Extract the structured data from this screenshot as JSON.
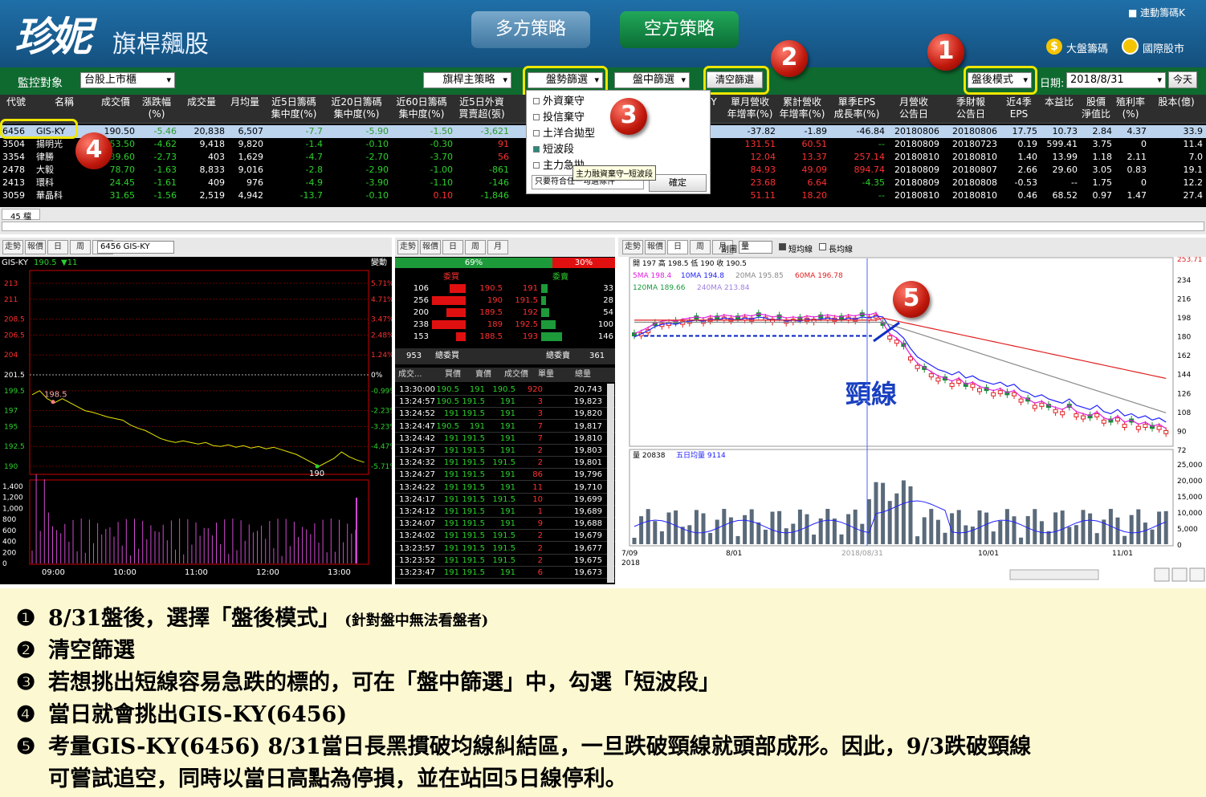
{
  "header": {
    "logo_main": "珍妮",
    "logo_sub": "旗桿飆股",
    "btn_long": "多方策略",
    "btn_short": "空方策略",
    "chip_check": "■ 連動籌碼K",
    "link_market_chips": "大盤籌碼",
    "link_global": "國際股市"
  },
  "filterbar": {
    "monitor_label": "監控對象",
    "monitor_value": "台股上市櫃",
    "strategy": "旗桿主策略",
    "trend_filter": "盤勢篩選",
    "intraday_filter": "盤中篩選",
    "clear_filter": "清空篩選",
    "mode": "盤後模式",
    "date_label": "日期:",
    "date_value": "2018/8/31",
    "today": "今天"
  },
  "callouts": [
    "1",
    "2",
    "3",
    "4",
    "5"
  ],
  "dropdown": {
    "items": [
      {
        "label": "外資棄守",
        "checked": false
      },
      {
        "label": "投信棄守",
        "checked": false
      },
      {
        "label": "土洋合拋型",
        "checked": false
      },
      {
        "label": "短波段",
        "checked": true
      },
      {
        "label": "主力急拋",
        "checked": false
      }
    ],
    "condition": "只要符合任一勾選條件",
    "ok": "確定",
    "tooltip": "主力融資棄守─短波段"
  },
  "grid": {
    "headers_left": [
      "代號",
      "名稱",
      "成交價",
      "漲跌幅\n(%)",
      "成交量",
      "月均量",
      "近5日籌碼\n集中度(%)",
      "近20日籌碼\n集中度(%)",
      "近60日籌碼\n集中度(%)",
      "近5日外資\n買賣超(張)"
    ],
    "headers_right": [
      "Y",
      "單月營收\n年增率(%)",
      "累計營收\n年增率(%)",
      "單季EPS\n成長率(%)",
      "月營收\n公告日",
      "季財報\n公告日",
      "近4季\nEPS",
      "本益比",
      "股價\n淨值比",
      "殖利率\n(%)",
      "股本(億)"
    ],
    "rows": [
      {
        "code": "6456",
        "name": "GIS-KY",
        "price": "190.50",
        "chg": "-5.46",
        "vol": "20,838",
        "mavg": "6,507",
        "c5": "-7.7",
        "c20": "-5.90",
        "c60": "-1.50",
        "f5": "-3,621",
        "m": "-37.82",
        "acc": "-1.89",
        "eps_g": "-46.84",
        "rev_d": "20180806",
        "fin_d": "20180806",
        "eps4": "17.75",
        "pe": "10.73",
        "pb": "2.84",
        "yld": "4.37",
        "cap": "33.9"
      },
      {
        "code": "3504",
        "name": "揚明光",
        "price": "53.50",
        "chg": "-4.62",
        "vol": "9,418",
        "mavg": "9,820",
        "c5": "-1.4",
        "c20": "-0.10",
        "c60": "-0.30",
        "f5": "91",
        "m": "131.51",
        "acc": "60.51",
        "eps_g": "--",
        "rev_d": "20180809",
        "fin_d": "20180723",
        "eps4": "0.19",
        "pe": "599.41",
        "pb": "3.75",
        "yld": "0",
        "cap": "11.4"
      },
      {
        "code": "3354",
        "name": "律勝",
        "price": "39.60",
        "chg": "-2.73",
        "vol": "403",
        "mavg": "1,629",
        "c5": "-4.7",
        "c20": "-2.70",
        "c60": "-3.70",
        "f5": "56",
        "m": "12.04",
        "acc": "13.37",
        "eps_g": "257.14",
        "rev_d": "20180810",
        "fin_d": "20180810",
        "eps4": "1.40",
        "pe": "13.99",
        "pb": "1.18",
        "yld": "2.11",
        "cap": "7.0"
      },
      {
        "code": "2478",
        "name": "大毅",
        "price": "78.70",
        "chg": "-1.63",
        "vol": "8,833",
        "mavg": "9,016",
        "c5": "-2.8",
        "c20": "-2.90",
        "c60": "-1.00",
        "f5": "-861",
        "m": "84.93",
        "acc": "49.09",
        "eps_g": "894.74",
        "rev_d": "20180809",
        "fin_d": "20180807",
        "eps4": "2.66",
        "pe": "29.60",
        "pb": "3.05",
        "yld": "0.83",
        "cap": "19.1"
      },
      {
        "code": "2413",
        "name": "環科",
        "price": "24.45",
        "chg": "-1.61",
        "vol": "409",
        "mavg": "976",
        "c5": "-4.9",
        "c20": "-3.90",
        "c60": "-1.10",
        "f5": "-146",
        "m": "23.68",
        "acc": "6.64",
        "eps_g": "-4.35",
        "rev_d": "20180809",
        "fin_d": "20180808",
        "eps4": "-0.53",
        "pe": "--",
        "pb": "1.75",
        "yld": "0",
        "cap": "12.2"
      },
      {
        "code": "3059",
        "name": "華晶科",
        "price": "31.65",
        "chg": "-1.56",
        "vol": "2,519",
        "mavg": "4,942",
        "c5": "-13.7",
        "c20": "-0.10",
        "c60": "0.10",
        "f5": "-1,846",
        "m": "51.11",
        "acc": "18.20",
        "eps_g": "--",
        "rev_d": "20180810",
        "fin_d": "20180810",
        "eps4": "0.46",
        "pe": "68.52",
        "pb": "0.97",
        "yld": "1.47",
        "cap": "27.4"
      }
    ],
    "count": "45 檔"
  },
  "left_chart": {
    "tabs": [
      "走勢",
      "報價",
      "日",
      "周",
      "月"
    ],
    "stock": "6456 GIS-KY",
    "title": "GIS-KY",
    "price": "190.5",
    "change": "▼11",
    "mode": "變動",
    "yticks": [
      "213",
      "211",
      "208.5",
      "206.5",
      "204",
      "201.5",
      "199.5",
      "197",
      "195",
      "192.5",
      "190"
    ],
    "pct": [
      "5.71%",
      "4.71%",
      "3.47%",
      "2.48%",
      "1.24%",
      "0%",
      "-0.99%",
      "-2.23%",
      "-3.23%",
      "-4.47%",
      "-5.71%"
    ],
    "high_label": "198.5",
    "low_label": "190",
    "vticks": [
      "1,400",
      "1,200",
      "1,000",
      "800",
      "600",
      "400",
      "200",
      "0"
    ],
    "xticks": [
      "09:00",
      "10:00",
      "11:00",
      "12:00",
      "13:00"
    ]
  },
  "mid_panel": {
    "tabs": [
      "走勢",
      "報價",
      "日",
      "周",
      "月"
    ],
    "buy_pct": "69%",
    "sell_pct": "30%",
    "buy_label": "委買",
    "sell_label": "委賣",
    "book": [
      [
        "106",
        "190.5",
        "191",
        "33"
      ],
      [
        "256",
        "190",
        "191.5",
        "28"
      ],
      [
        "200",
        "189.5",
        "192",
        "54"
      ],
      [
        "238",
        "189",
        "192.5",
        "100"
      ],
      [
        "153",
        "188.5",
        "193",
        "146"
      ]
    ],
    "tot_buy": "953",
    "tot_buy_label": "總委買",
    "tot_sell_label": "總委賣",
    "tot_sell": "361",
    "tick_headers": [
      "成交...",
      "買價",
      "賣價",
      "成交價",
      "單量",
      "總量"
    ],
    "ticks": [
      [
        "13:30:00",
        "190.5",
        "191",
        "190.5",
        "920",
        "20,743"
      ],
      [
        "13:24:57",
        "190.5",
        "191.5",
        "191",
        "3",
        "19,823"
      ],
      [
        "13:24:52",
        "191",
        "191.5",
        "191",
        "3",
        "19,820"
      ],
      [
        "13:24:47",
        "190.5",
        "191",
        "191",
        "7",
        "19,817"
      ],
      [
        "13:24:42",
        "191",
        "191.5",
        "191",
        "7",
        "19,810"
      ],
      [
        "13:24:37",
        "191",
        "191.5",
        "191",
        "2",
        "19,803"
      ],
      [
        "13:24:32",
        "191",
        "191.5",
        "191.5",
        "2",
        "19,801"
      ],
      [
        "13:24:27",
        "191",
        "191.5",
        "191",
        "86",
        "19,796"
      ],
      [
        "13:24:22",
        "191",
        "191.5",
        "191",
        "11",
        "19,710"
      ],
      [
        "13:24:17",
        "191",
        "191.5",
        "191.5",
        "10",
        "19,699"
      ],
      [
        "13:24:12",
        "191",
        "191.5",
        "191",
        "1",
        "19,689"
      ],
      [
        "13:24:07",
        "191",
        "191.5",
        "191",
        "9",
        "19,688"
      ],
      [
        "13:24:02",
        "191",
        "191.5",
        "191.5",
        "2",
        "19,679"
      ],
      [
        "13:23:57",
        "191",
        "191.5",
        "191.5",
        "2",
        "19,677"
      ],
      [
        "13:23:52",
        "191",
        "191.5",
        "191.5",
        "2",
        "19,675"
      ],
      [
        "13:23:47",
        "191",
        "191.5",
        "191",
        "6",
        "19,673"
      ]
    ]
  },
  "right_chart": {
    "tabs": [
      "走勢",
      "報價",
      "日",
      "周",
      "月"
    ],
    "sub_label": "副圖",
    "sub_value": "量",
    "short_line": "短均線",
    "long_line": "長均線",
    "ohlc": "開 197  高 198.5  低 190  收 190.5",
    "ma5": "5MA 198.4",
    "ma10": "10MA 194.8",
    "ma20": "20MA 195.85",
    "ma60": "60MA 196.78",
    "ma120": "120MA 189.66",
    "ma240": "240MA 213.84",
    "yticks": [
      "253.71",
      "234",
      "216",
      "198",
      "180",
      "162",
      "144",
      "126",
      "108",
      "90",
      "72"
    ],
    "neckline": "頸線",
    "vol_label": "量 20838",
    "vol_ma": "五日均量 9114",
    "vticks": [
      "25,000",
      "20,000",
      "15,000",
      "10,000",
      "5,000",
      "0"
    ],
    "xticks": [
      "7/09\n2018",
      "8/01",
      "2018/08/31",
      "10/01",
      "11/01"
    ]
  },
  "notes": [
    {
      "bullet": "❶",
      "text": "8/31盤後，選擇「盤後模式」",
      "small": "(針對盤中無法看盤者)"
    },
    {
      "bullet": "❷",
      "text": "清空篩選"
    },
    {
      "bullet": "❸",
      "text": "若想挑出短線容易急跌的標的，可在「盤中篩選」中，勾選「短波段」"
    },
    {
      "bullet": "❹",
      "text": "當日就會挑出GIS-KY(6456)"
    },
    {
      "bullet": "❺",
      "text": "考量GIS-KY(6456) 8/31當日長黑摜破均線糾結區，一旦跌破頸線就頭部成形。因此，9/3跌破頸線"
    },
    {
      "bullet": "",
      "text": "可嘗試追空，同時以當日高點為停損，並在站回5日線停利。"
    }
  ],
  "colors": {
    "header": "#14507e",
    "filterbar": "#0f6a2f",
    "callout": "#c0180c",
    "highlight": "#f0e600",
    "notes_bg": "#fcf8d2"
  }
}
